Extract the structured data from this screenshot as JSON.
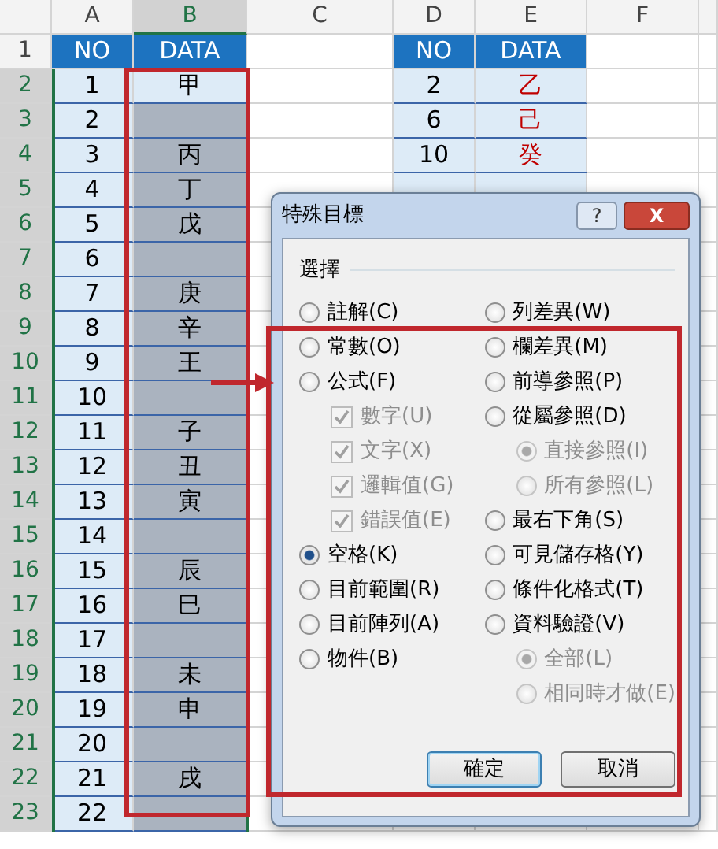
{
  "sheet": {
    "columns": [
      {
        "label": "A",
        "selected": false
      },
      {
        "label": "B",
        "selected": true
      },
      {
        "label": "C",
        "selected": false
      },
      {
        "label": "D",
        "selected": false
      },
      {
        "label": "E",
        "selected": false
      },
      {
        "label": "F",
        "selected": false
      }
    ],
    "rows": [
      {
        "header": "1",
        "selected": false,
        "kind": "title",
        "cells": {
          "a": "NO",
          "b": "DATA",
          "d": "NO",
          "e": "DATA"
        }
      },
      {
        "header": "2",
        "selected": true,
        "active": true,
        "kind": "data",
        "cells": {
          "a": "1",
          "b": "甲",
          "d": "2",
          "e": "乙"
        }
      },
      {
        "header": "3",
        "selected": true,
        "active": false,
        "kind": "data",
        "cells": {
          "a": "2",
          "d": "6",
          "e": "己"
        }
      },
      {
        "header": "4",
        "selected": true,
        "active": false,
        "kind": "data",
        "cells": {
          "a": "3",
          "b": "丙",
          "d": "10",
          "e": "癸"
        }
      },
      {
        "header": "5",
        "selected": true,
        "active": false,
        "kind": "data",
        "cells": {
          "a": "4",
          "b": "丁"
        }
      },
      {
        "header": "6",
        "selected": true,
        "active": false,
        "kind": "data",
        "cells": {
          "a": "5",
          "b": "戊"
        }
      },
      {
        "header": "7",
        "selected": true,
        "active": false,
        "kind": "data",
        "cells": {
          "a": "6"
        }
      },
      {
        "header": "8",
        "selected": true,
        "active": false,
        "kind": "data",
        "cells": {
          "a": "7",
          "b": "庚"
        }
      },
      {
        "header": "9",
        "selected": true,
        "active": false,
        "kind": "data",
        "cells": {
          "a": "8",
          "b": "辛"
        }
      },
      {
        "header": "10",
        "selected": true,
        "active": false,
        "kind": "data",
        "cells": {
          "a": "9",
          "b": "王"
        }
      },
      {
        "header": "11",
        "selected": true,
        "active": false,
        "kind": "data",
        "cells": {
          "a": "10"
        }
      },
      {
        "header": "12",
        "selected": true,
        "active": false,
        "kind": "data",
        "cells": {
          "a": "11",
          "b": "子"
        }
      },
      {
        "header": "13",
        "selected": true,
        "active": false,
        "kind": "data",
        "cells": {
          "a": "12",
          "b": "丑"
        }
      },
      {
        "header": "14",
        "selected": true,
        "active": false,
        "kind": "data",
        "cells": {
          "a": "13",
          "b": "寅"
        }
      },
      {
        "header": "15",
        "selected": true,
        "active": false,
        "kind": "data",
        "cells": {
          "a": "14"
        }
      },
      {
        "header": "16",
        "selected": true,
        "active": false,
        "kind": "data",
        "cells": {
          "a": "15",
          "b": "辰"
        }
      },
      {
        "header": "17",
        "selected": true,
        "active": false,
        "kind": "data",
        "cells": {
          "a": "16",
          "b": "巳"
        }
      },
      {
        "header": "18",
        "selected": true,
        "active": false,
        "kind": "data",
        "cells": {
          "a": "17"
        }
      },
      {
        "header": "19",
        "selected": true,
        "active": false,
        "kind": "data",
        "cells": {
          "a": "18",
          "b": "未"
        }
      },
      {
        "header": "20",
        "selected": true,
        "active": false,
        "kind": "data",
        "cells": {
          "a": "19",
          "b": "申"
        }
      },
      {
        "header": "21",
        "selected": true,
        "active": false,
        "kind": "data",
        "cells": {
          "a": "20"
        }
      },
      {
        "header": "22",
        "selected": true,
        "active": false,
        "kind": "data",
        "cells": {
          "a": "21",
          "b": "戌"
        }
      },
      {
        "header": "23",
        "selected": true,
        "active": false,
        "kind": "data",
        "cells": {
          "a": "22"
        }
      }
    ]
  },
  "dialog": {
    "title": "特殊目標",
    "help_button": "?",
    "close_button": "X",
    "group_label": "選擇",
    "left_options": [
      {
        "kind": "radio",
        "label": "註解(C)",
        "selected": false,
        "disabled": false
      },
      {
        "kind": "radio",
        "label": "常數(O)",
        "selected": false,
        "disabled": false
      },
      {
        "kind": "radio",
        "label": "公式(F)",
        "selected": false,
        "disabled": false,
        "children": [
          {
            "kind": "checkbox",
            "label": "數字(U)",
            "checked": true,
            "disabled": true
          },
          {
            "kind": "checkbox",
            "label": "文字(X)",
            "checked": true,
            "disabled": true
          },
          {
            "kind": "checkbox",
            "label": "邏輯值(G)",
            "checked": true,
            "disabled": true
          },
          {
            "kind": "checkbox",
            "label": "錯誤值(E)",
            "checked": true,
            "disabled": true
          }
        ]
      },
      {
        "kind": "radio",
        "label": "空格(K)",
        "selected": true,
        "disabled": false
      },
      {
        "kind": "radio",
        "label": "目前範圍(R)",
        "selected": false,
        "disabled": false
      },
      {
        "kind": "radio",
        "label": "目前陣列(A)",
        "selected": false,
        "disabled": false
      },
      {
        "kind": "radio",
        "label": "物件(B)",
        "selected": false,
        "disabled": false
      }
    ],
    "right_options": [
      {
        "kind": "radio",
        "label": "列差異(W)",
        "selected": false,
        "disabled": false
      },
      {
        "kind": "radio",
        "label": "欄差異(M)",
        "selected": false,
        "disabled": false
      },
      {
        "kind": "radio",
        "label": "前導參照(P)",
        "selected": false,
        "disabled": false
      },
      {
        "kind": "radio",
        "label": "從屬參照(D)",
        "selected": false,
        "disabled": false,
        "children": [
          {
            "kind": "radio",
            "label": "直接參照(I)",
            "selected": true,
            "disabled": true
          },
          {
            "kind": "radio",
            "label": "所有參照(L)",
            "selected": false,
            "disabled": true
          }
        ]
      },
      {
        "kind": "radio",
        "label": "最右下角(S)",
        "selected": false,
        "disabled": false
      },
      {
        "kind": "radio",
        "label": "可見儲存格(Y)",
        "selected": false,
        "disabled": false
      },
      {
        "kind": "radio",
        "label": "條件化格式(T)",
        "selected": false,
        "disabled": false
      },
      {
        "kind": "radio",
        "label": "資料驗證(V)",
        "selected": false,
        "disabled": false,
        "children": [
          {
            "kind": "radio",
            "label": "全部(L)",
            "selected": true,
            "disabled": true
          },
          {
            "kind": "radio",
            "label": "相同時才做(E)",
            "selected": false,
            "disabled": true
          }
        ]
      }
    ],
    "buttons": [
      {
        "label": "確定",
        "default": true
      },
      {
        "label": "取消",
        "default": false
      }
    ]
  }
}
